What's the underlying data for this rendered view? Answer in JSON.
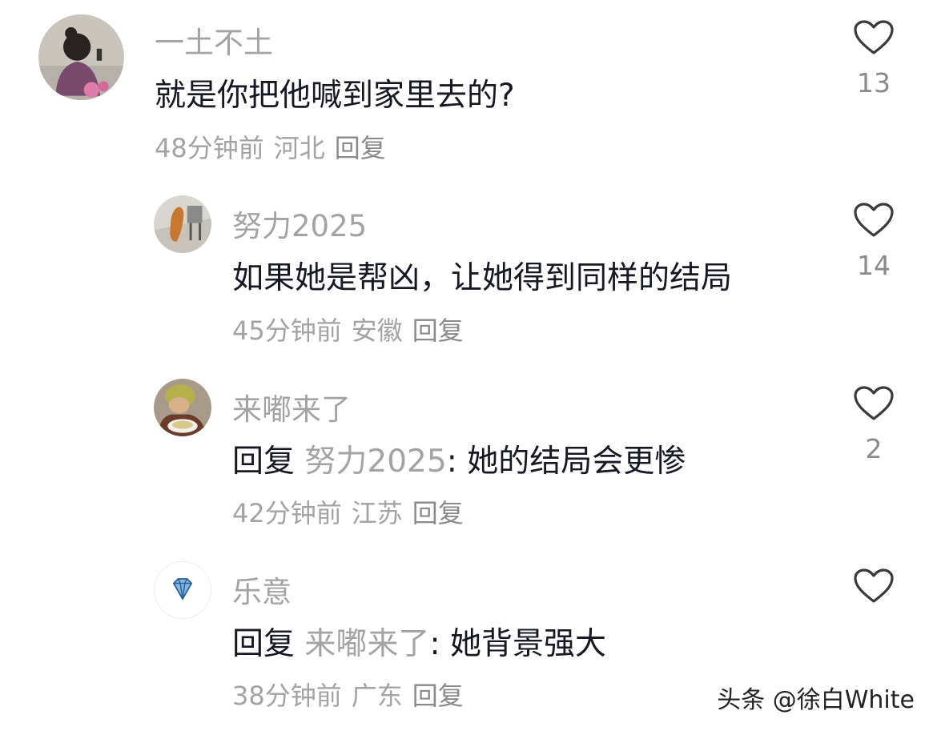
{
  "comments": [
    {
      "username": "一土不土",
      "text": "就是你把他喊到家里去的?",
      "time": "48分钟前",
      "location": "河北",
      "reply_label": "回复",
      "likes": "13"
    },
    {
      "username": "努力2025",
      "text": "如果她是帮凶，让她得到同样的结局",
      "time": "45分钟前",
      "location": "安徽",
      "reply_label": "回复",
      "likes": "14"
    },
    {
      "username": "来嘟来了",
      "reply_prefix": "回复",
      "mention": "努力2025",
      "text": ": 她的结局会更惨",
      "time": "42分钟前",
      "location": "江苏",
      "reply_label": "回复",
      "likes": "2"
    },
    {
      "username": "乐意",
      "reply_prefix": "回复",
      "mention": "来嘟来了",
      "text": ": 她背景强大",
      "time": "38分钟前",
      "location": "广东",
      "reply_label": "回复",
      "likes": ""
    }
  ],
  "icons": {
    "like": "heart-outline-icon",
    "avatar4": "diamond-icon"
  },
  "colors": {
    "text": "#161823",
    "muted": "#a3a3a3"
  },
  "watermark": "头条 @徐白White"
}
